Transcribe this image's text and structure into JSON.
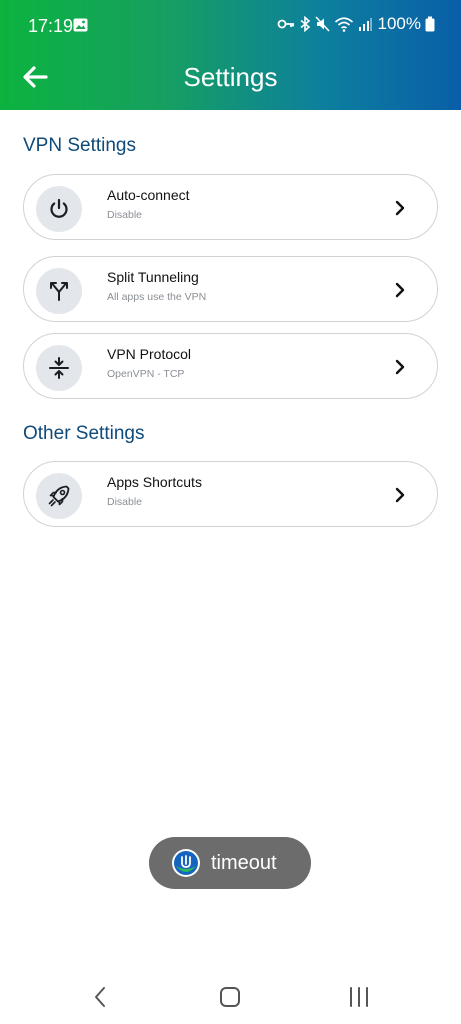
{
  "status_bar": {
    "time": "17:19",
    "battery": "100%"
  },
  "header": {
    "title": "Settings",
    "gradient_colors": [
      "#0cb33f",
      "#0a5ea8"
    ]
  },
  "sections": [
    {
      "title": "VPN Settings",
      "items": [
        {
          "title": "Auto-connect",
          "subtitle": "Disable",
          "icon": "power-icon"
        },
        {
          "title": "Split Tunneling",
          "subtitle": "All apps use the VPN",
          "icon": "split-icon"
        },
        {
          "title": "VPN Protocol",
          "subtitle": "OpenVPN - TCP",
          "icon": "protocol-icon"
        }
      ]
    },
    {
      "title": "Other Settings",
      "items": [
        {
          "title": "Apps Shortcuts",
          "subtitle": "Disable",
          "icon": "rocket-icon"
        }
      ]
    }
  ],
  "toast": {
    "text": "timeout"
  },
  "colors": {
    "section_title": "#0e4a7a",
    "card_border": "#cfd3d8",
    "icon_bg": "#e3e6ea"
  }
}
